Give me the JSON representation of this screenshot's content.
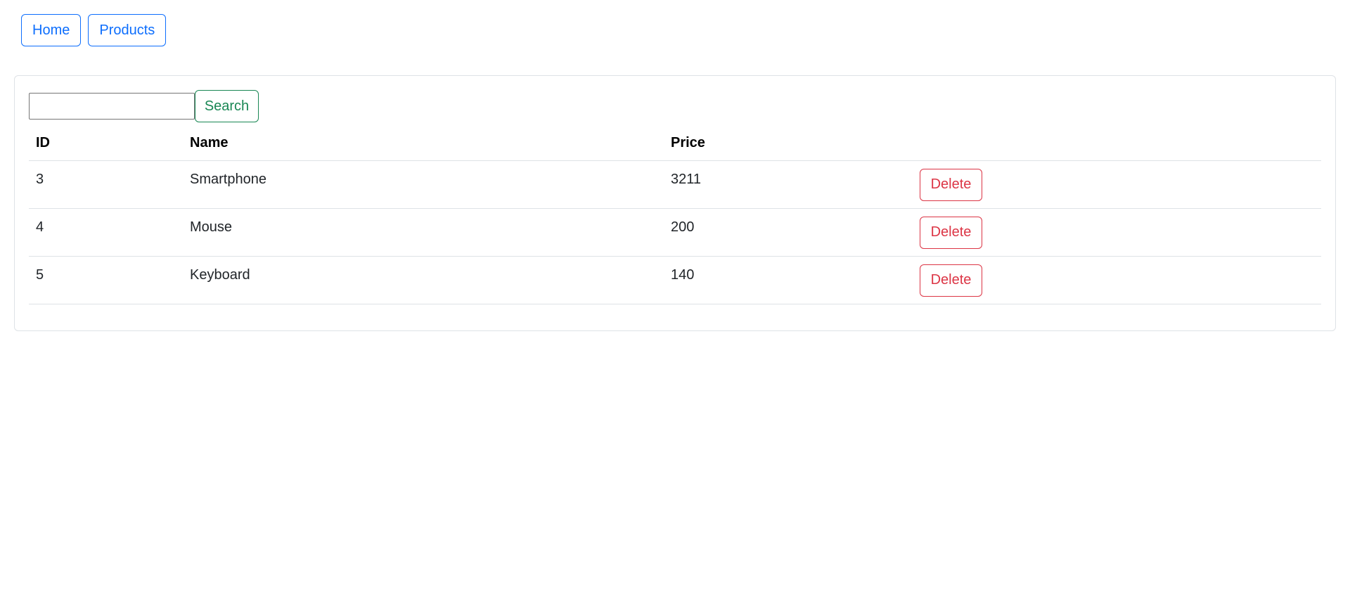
{
  "nav": {
    "home_label": "Home",
    "products_label": "Products"
  },
  "search": {
    "value": "",
    "placeholder": "",
    "button_label": "Search"
  },
  "table": {
    "headers": {
      "id": "ID",
      "name": "Name",
      "price": "Price",
      "action": ""
    },
    "rows": [
      {
        "id": "3",
        "name": "Smartphone",
        "price": "3211",
        "delete_label": "Delete"
      },
      {
        "id": "4",
        "name": "Mouse",
        "price": "200",
        "delete_label": "Delete"
      },
      {
        "id": "5",
        "name": "Keyboard",
        "price": "140",
        "delete_label": "Delete"
      }
    ]
  },
  "colors": {
    "primary": "#0d6efd",
    "success": "#198754",
    "danger": "#dc3545",
    "border": "#dee2e6"
  }
}
